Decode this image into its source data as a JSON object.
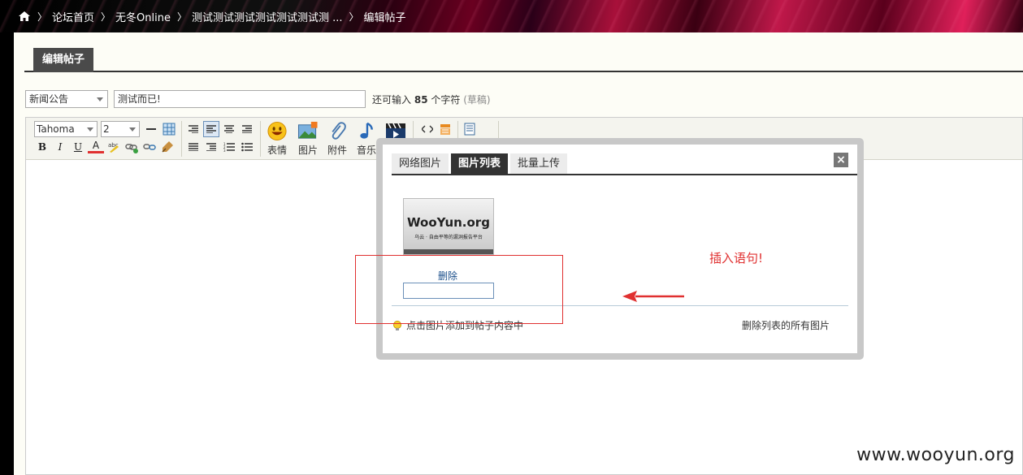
{
  "breadcrumb": {
    "items": [
      "论坛首页",
      "无冬Online",
      "测试测试测试测试测试测试测 ...",
      "编辑帖子"
    ]
  },
  "page": {
    "tab_label": "编辑帖子"
  },
  "form": {
    "category_value": "新闻公告",
    "subject_value": "测试而已!",
    "char_hint_prefix": "还可输入",
    "char_count": "85",
    "char_hint_suffix": "个字符",
    "draft_label": "(草稿)"
  },
  "toolbar": {
    "font_family": "Tahoma",
    "font_size": "2",
    "bold": "B",
    "italic": "I",
    "underline": "U",
    "font_color": "A",
    "emoji_label": "表情",
    "image_label": "图片",
    "attach_label": "附件",
    "music_label": "音乐"
  },
  "dialog": {
    "tabs": [
      {
        "label": "网络图片",
        "active": false
      },
      {
        "label": "图片列表",
        "active": true
      },
      {
        "label": "批量上传",
        "active": false
      }
    ],
    "thumb_logo": "WooYun.org",
    "thumb_slogan": "乌云 · 自由平等的漏洞报告平台",
    "delete_label": "删除",
    "hint_text": "点击图片添加到帖子内容中",
    "delete_all_label": "删除列表的所有图片"
  },
  "annotation": {
    "text": "插入语句!"
  },
  "watermark": "www.wooyun.org",
  "colors": {
    "accent_red": "#e03030",
    "tab_dark": "#4a4a4a",
    "link_blue": "#1a4e8a"
  }
}
